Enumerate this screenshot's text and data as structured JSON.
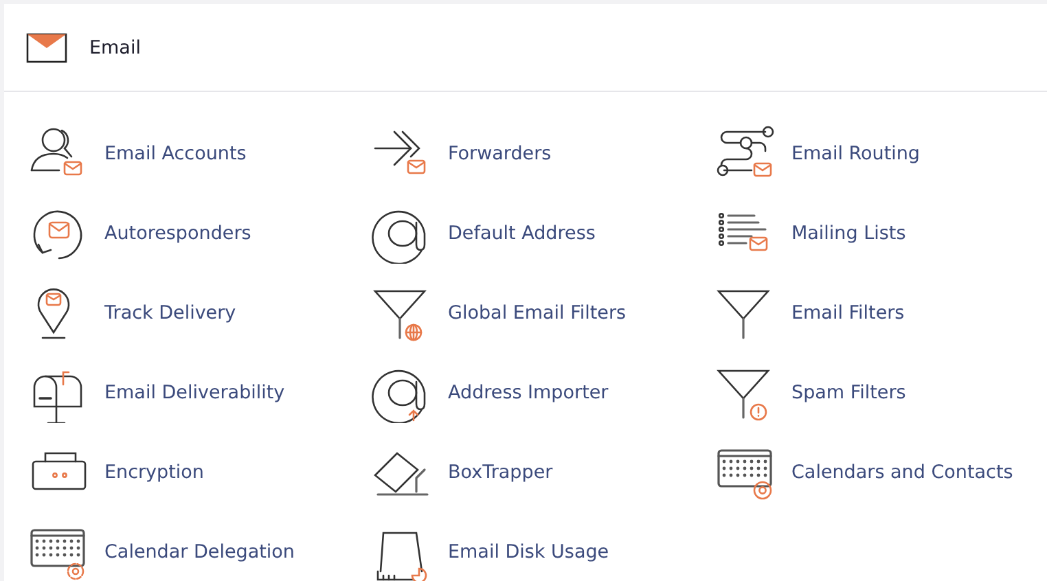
{
  "panel": {
    "title": "Email"
  },
  "items": [
    {
      "label": "Email Accounts",
      "kind": "accounts"
    },
    {
      "label": "Forwarders",
      "kind": "forwarders"
    },
    {
      "label": "Email Routing",
      "kind": "routing"
    },
    {
      "label": "Autoresponders",
      "kind": "autoresponders"
    },
    {
      "label": "Default Address",
      "kind": "default-address"
    },
    {
      "label": "Mailing Lists",
      "kind": "mailing-lists"
    },
    {
      "label": "Track Delivery",
      "kind": "track"
    },
    {
      "label": "Global Email Filters",
      "kind": "global-filters"
    },
    {
      "label": "Email Filters",
      "kind": "filters"
    },
    {
      "label": "Email Deliverability",
      "kind": "deliverability"
    },
    {
      "label": "Address Importer",
      "kind": "importer"
    },
    {
      "label": "Spam Filters",
      "kind": "spam"
    },
    {
      "label": "Encryption",
      "kind": "encryption"
    },
    {
      "label": "BoxTrapper",
      "kind": "boxtrapper"
    },
    {
      "label": "Calendars and Contacts",
      "kind": "calendars"
    },
    {
      "label": "Calendar Delegation",
      "kind": "delegation"
    },
    {
      "label": "Email Disk Usage",
      "kind": "disk-usage"
    }
  ]
}
